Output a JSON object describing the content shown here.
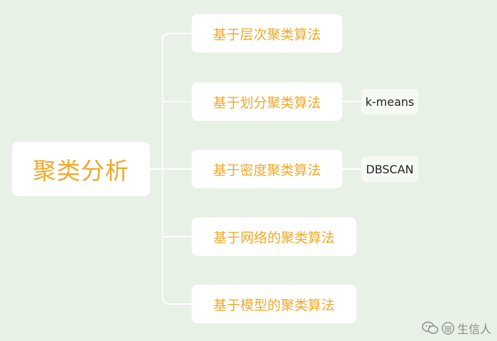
{
  "mindmap": {
    "root": {
      "label": "聚类分析"
    },
    "branches": [
      {
        "label": "基于层次聚类算法"
      },
      {
        "label": "基于划分聚类算法",
        "leaf": "k-means"
      },
      {
        "label": "基于密度聚类算法",
        "leaf": "DBSCAN"
      },
      {
        "label": "基于网络的聚类算法"
      },
      {
        "label": "基于模型的聚类算法"
      }
    ]
  },
  "watermark": {
    "text": "生信人"
  },
  "colors": {
    "background": "#e8f1e6",
    "node_fill": "#ffffff",
    "node_text": "#f0a92a",
    "connector": "#ffffff",
    "leaf_text": "#222222"
  }
}
